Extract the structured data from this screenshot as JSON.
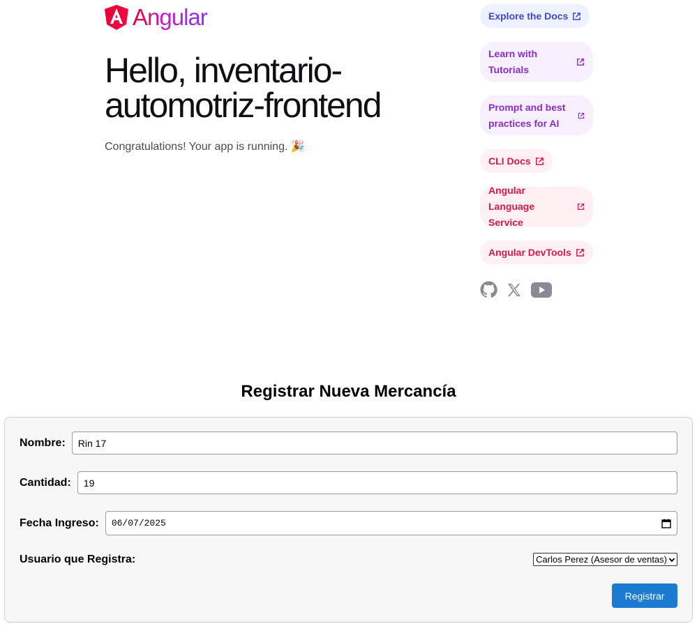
{
  "brand": {
    "name": "Angular"
  },
  "hero": {
    "title": "Hello, inventario-automotriz-frontend",
    "subtitle": "Congratulations! Your app is running. 🎉"
  },
  "links": [
    {
      "label": "Explore the Docs",
      "color": "#3b46d8"
    },
    {
      "label": "Learn with Tutorials",
      "color": "#8a2bd0"
    },
    {
      "label": "Prompt and best practices for AI",
      "color": "#8a2bd0"
    },
    {
      "label": "CLI Docs",
      "color": "#d7184b"
    },
    {
      "label": "Angular Language Service",
      "color": "#d7184b"
    },
    {
      "label": "Angular DevTools",
      "color": "#d7184b"
    }
  ],
  "socials": [
    "github-icon",
    "x-icon",
    "youtube-icon"
  ],
  "form": {
    "title": "Registrar Nueva Mercancía",
    "nombre_label": "Nombre:",
    "nombre_value": "Rin 17",
    "cantidad_label": "Cantidad:",
    "cantidad_value": "19",
    "fecha_label": "Fecha Ingreso:",
    "fecha_value": "06/07/2025",
    "usuario_label": "Usuario que Registra:",
    "usuario_value": "Carlos Perez (Asesor de ventas)",
    "submit_label": "Registrar",
    "submit_color": "#1d7ad1"
  }
}
